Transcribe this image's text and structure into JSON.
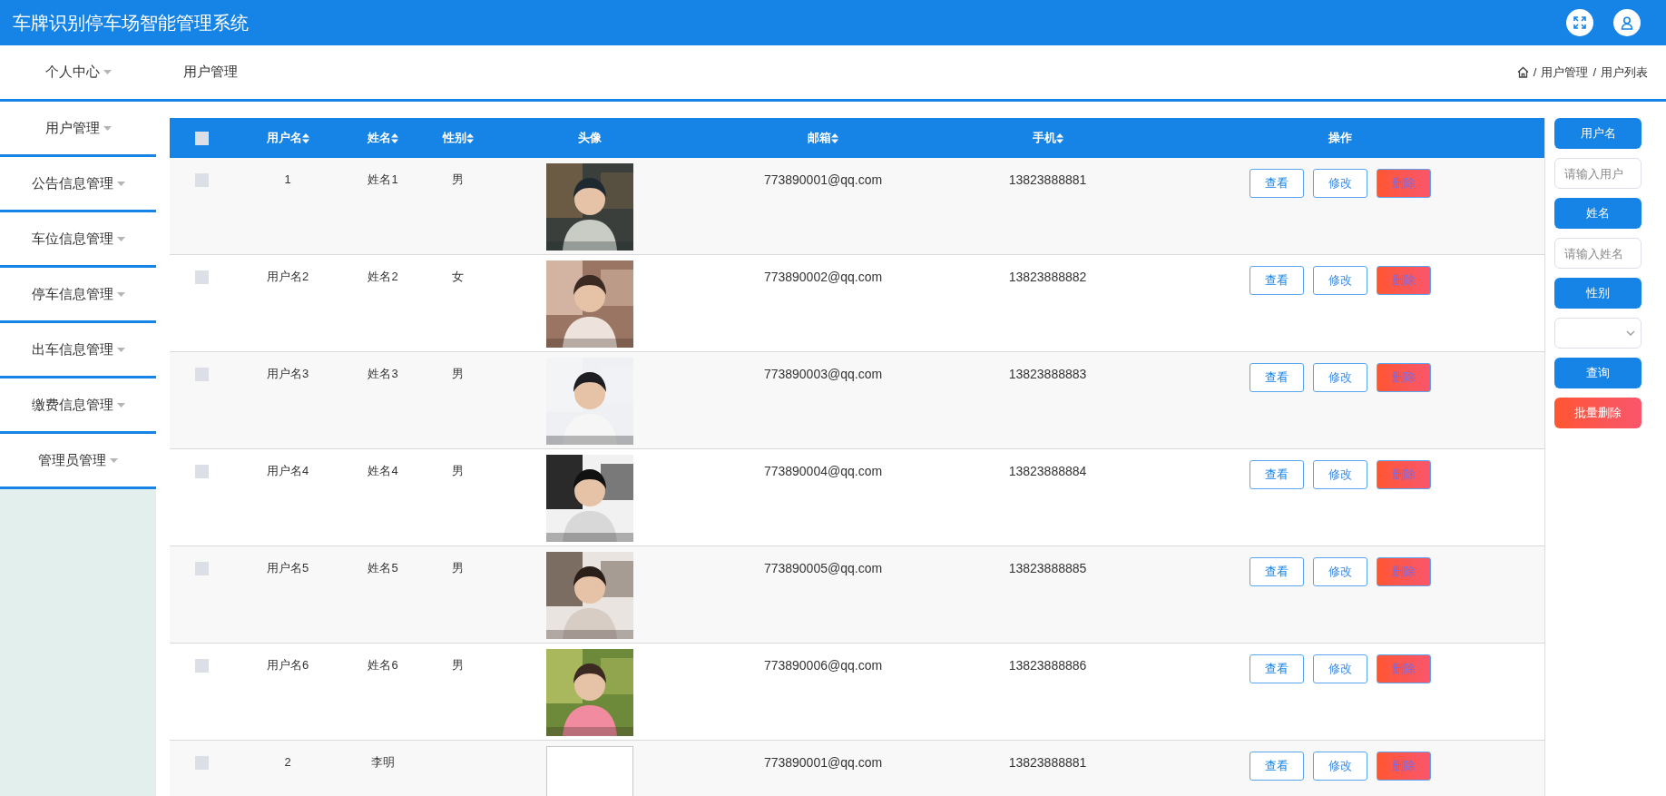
{
  "app_title": "车牌识别停车场智能管理系统",
  "sidebar": {
    "items": [
      {
        "label": "个人中心"
      },
      {
        "label": "用户管理"
      },
      {
        "label": "公告信息管理"
      },
      {
        "label": "车位信息管理"
      },
      {
        "label": "停车信息管理"
      },
      {
        "label": "出车信息管理"
      },
      {
        "label": "缴费信息管理"
      },
      {
        "label": "管理员管理"
      }
    ]
  },
  "page_title": "用户管理",
  "breadcrumb": {
    "separator": "/",
    "items": [
      "用户管理",
      "用户列表"
    ]
  },
  "table": {
    "select_all_checked": false,
    "columns": [
      {
        "label": "用户名",
        "sortable": true
      },
      {
        "label": "姓名",
        "sortable": true
      },
      {
        "label": "性别",
        "sortable": true
      },
      {
        "label": "头像",
        "sortable": false
      },
      {
        "label": "邮箱",
        "sortable": true
      },
      {
        "label": "手机",
        "sortable": true
      },
      {
        "label": "操作",
        "sortable": false
      }
    ],
    "rows": [
      {
        "checked": false,
        "username": "1",
        "name": "姓名1",
        "gender": "男",
        "email": "773890001@qq.com",
        "phone": "13823888881",
        "actions": [
          "查看",
          "修改",
          "删除"
        ]
      },
      {
        "checked": false,
        "username": "用户名2",
        "name": "姓名2",
        "gender": "女",
        "email": "773890002@qq.com",
        "phone": "13823888882",
        "actions": [
          "查看",
          "修改",
          "删除"
        ]
      },
      {
        "checked": false,
        "username": "用户名3",
        "name": "姓名3",
        "gender": "男",
        "email": "773890003@qq.com",
        "phone": "13823888883",
        "actions": [
          "查看",
          "修改",
          "删除"
        ]
      },
      {
        "checked": false,
        "username": "用户名4",
        "name": "姓名4",
        "gender": "男",
        "email": "773890004@qq.com",
        "phone": "13823888884",
        "actions": [
          "查看",
          "修改",
          "删除"
        ]
      },
      {
        "checked": false,
        "username": "用户名5",
        "name": "姓名5",
        "gender": "男",
        "email": "773890005@qq.com",
        "phone": "13823888885",
        "actions": [
          "查看",
          "修改",
          "删除"
        ]
      },
      {
        "checked": false,
        "username": "用户名6",
        "name": "姓名6",
        "gender": "男",
        "email": "773890006@qq.com",
        "phone": "13823888886",
        "actions": [
          "查看",
          "修改",
          "删除"
        ]
      },
      {
        "checked": false,
        "username": "2",
        "name": "李明",
        "avatar": {
          "kind": "broken"
        },
        "email": "773890001@qq.com",
        "phone": "13823888881",
        "actions": [
          "查看",
          "修改",
          "删除"
        ]
      }
    ]
  },
  "filters": [
    {
      "kind": "label",
      "text": "用户名"
    },
    {
      "kind": "input",
      "placeholder": "请输入用户"
    },
    {
      "kind": "label",
      "text": "姓名"
    },
    {
      "kind": "input",
      "placeholder": "请输入姓名"
    },
    {
      "kind": "label",
      "text": "性别"
    },
    {
      "kind": "select"
    },
    {
      "kind": "button",
      "text": "查询"
    },
    {
      "kind": "danger",
      "text": "批量删除"
    }
  ]
}
